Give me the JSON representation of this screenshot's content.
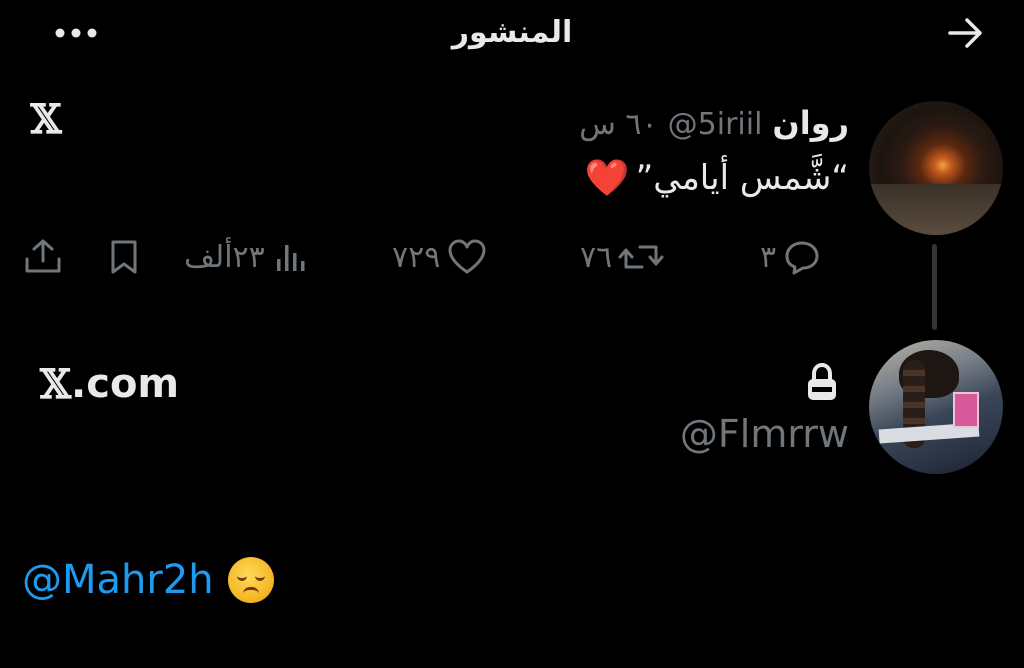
{
  "header": {
    "title": "المنشور",
    "back_icon": "arrow-right-icon",
    "more_icon": "more-horizontal-icon"
  },
  "post": {
    "author_name": "روان",
    "author_handle": "@5iriil",
    "time": "٦٠ س",
    "text": "”شَّمس أيامي“",
    "emoji": "❤️",
    "x_logo": "𝕏",
    "stats": {
      "replies": "٣",
      "reposts": "٧٦",
      "likes": "٧٢٩",
      "views": "٢٣ألف"
    }
  },
  "quoted": {
    "site_x": "𝕏",
    "site_suffix": ".com",
    "handle": "@Flmrrw",
    "lock_icon": "lock-icon"
  },
  "reply": {
    "mention": "@Mahr2h",
    "emoji_name": "pensive-face-emoji"
  },
  "colors": {
    "background": "#000000",
    "text_primary": "#e7e9ea",
    "text_secondary": "#71767b",
    "link": "#1d9bf0"
  }
}
